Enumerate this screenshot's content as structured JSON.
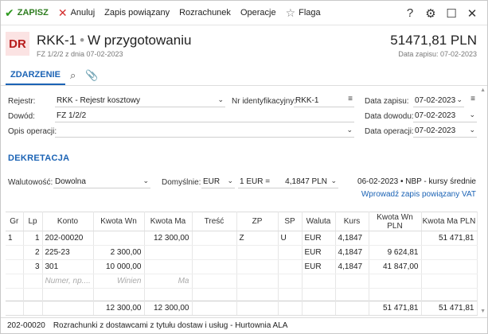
{
  "toolbar": {
    "save_label": "ZAPISZ",
    "cancel_label": "Anuluj",
    "related_label": "Zapis powiązany",
    "settlement_label": "Rozrachunek",
    "operations_label": "Operacje",
    "flag_label": "Flaga"
  },
  "window": {
    "help": "?",
    "settings_icon": "gear-icon",
    "maximize_icon": "square-icon",
    "close_icon": "close-icon"
  },
  "header": {
    "badge": "DR",
    "doc_code": "RKK-1",
    "status": "W przygotowaniu",
    "subtitle": "FZ 1/2/2 z dnia 07-02-2023",
    "amount": "51471,81 PLN",
    "record_date": "Data zapisu: 07-02-2023"
  },
  "tabs": {
    "event": "ZDARZENIE"
  },
  "form": {
    "register_label": "Rejestr:",
    "register_value": "RKK - Rejestr kosztowy",
    "id_label": "Nr identyfikacyjny:",
    "id_value": "RKK-1",
    "record_date_label": "Data zapisu:",
    "record_date_value": "07-02-2023",
    "proof_label": "Dowód:",
    "proof_value": "FZ 1/2/2",
    "proof_date_label": "Data dowodu:",
    "proof_date_value": "07-02-2023",
    "desc_label": "Opis operacji:",
    "desc_value": "",
    "op_date_label": "Data operacji:",
    "op_date_value": "07-02-2023"
  },
  "decree": {
    "title": "DEKRETACJA",
    "currency_label": "Walutowość:",
    "currency_value": "Dowolna",
    "default_label": "Domyślnie:",
    "default_currency": "EUR",
    "rate_base": "1 EUR =",
    "rate_value": "4,1847 PLN",
    "rate_info": "06-02-2023 • NBP - kursy średnie",
    "link": "Wprowadź zapis powiązany VAT"
  },
  "table": {
    "headers": [
      "Gr",
      "Lp",
      "Konto",
      "Kwota Wn",
      "Kwota Ma",
      "Treść",
      "ZP",
      "SP",
      "Waluta",
      "Kurs",
      "Kwota Wn PLN",
      "Kwota Ma PLN"
    ],
    "rows": [
      [
        "1",
        "1",
        "202-00020",
        "",
        "12 300,00",
        "",
        "Z",
        "U",
        "EUR",
        "4,1847",
        "",
        "51 471,81"
      ],
      [
        "",
        "2",
        "225-23",
        "2 300,00",
        "",
        "",
        "",
        "",
        "EUR",
        "4,1847",
        "9 624,81",
        ""
      ],
      [
        "",
        "3",
        "301",
        "10 000,00",
        "",
        "",
        "",
        "",
        "EUR",
        "4,1847",
        "41 847,00",
        ""
      ]
    ],
    "placeholders": {
      "account": "Numer, np....",
      "debit": "Winien",
      "credit": "Ma"
    },
    "totals": {
      "debit": "12 300,00",
      "credit": "12 300,00",
      "debit_pln": "51 471,81",
      "credit_pln": "51 471,81"
    }
  },
  "status": {
    "account": "202-00020",
    "description": "Rozrachunki z dostawcami z tytułu dostaw i usług - Hurtownia ALA"
  }
}
